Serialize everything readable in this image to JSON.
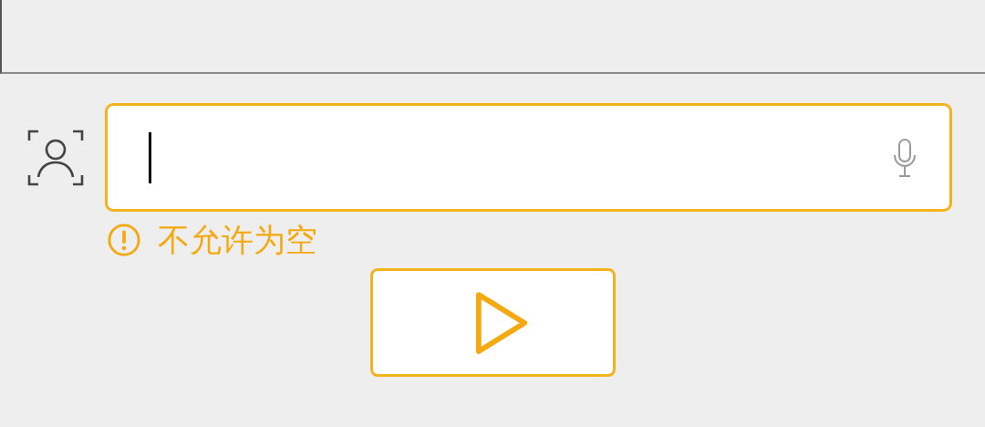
{
  "input": {
    "focused": true
  },
  "error_message": "不允许为空"
}
